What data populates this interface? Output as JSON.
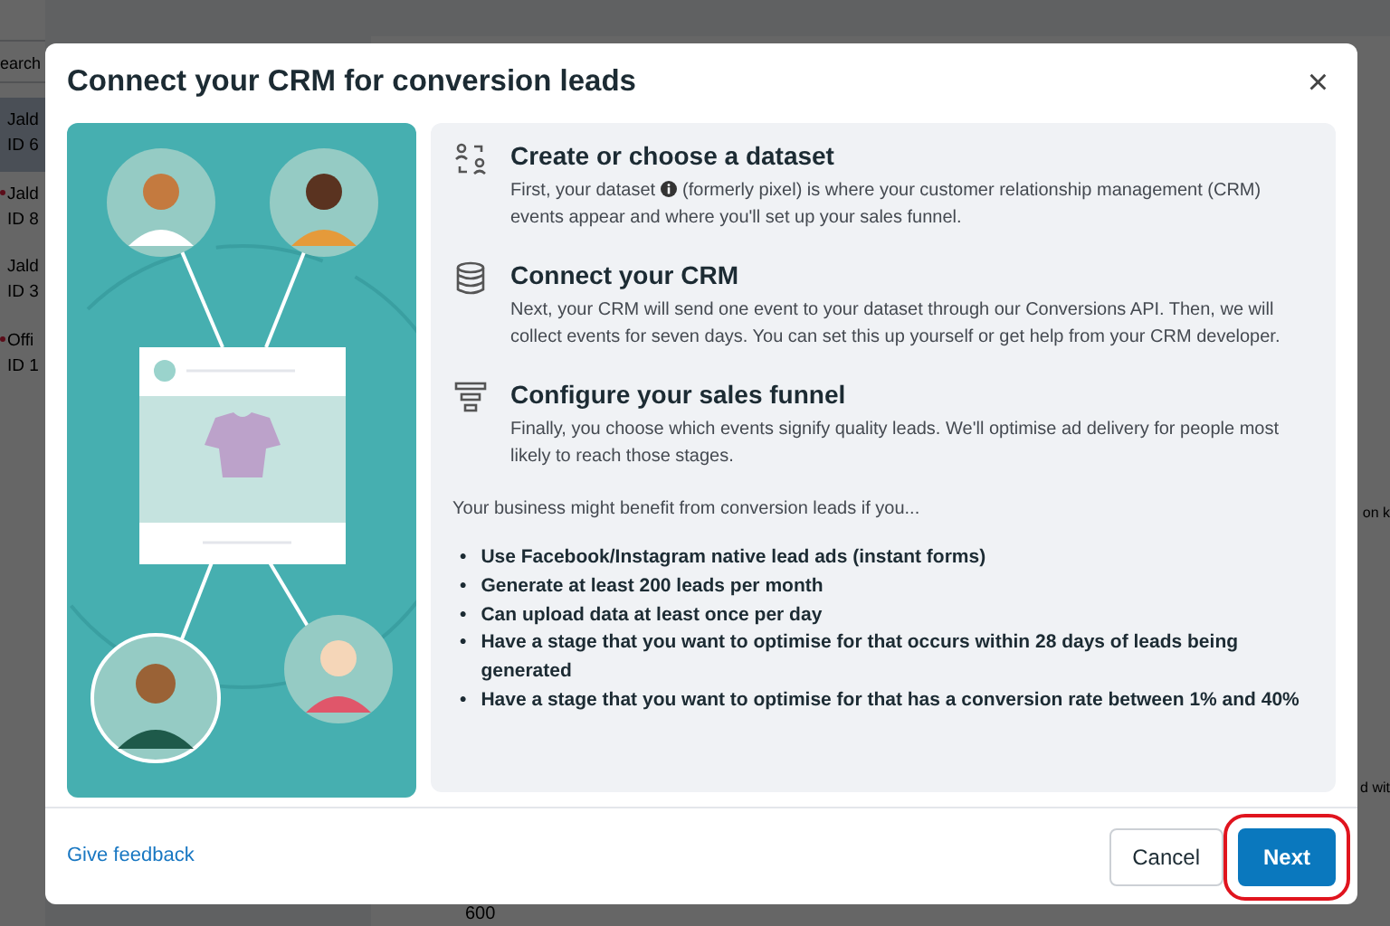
{
  "background": {
    "search_placeholder": "earch",
    "list": [
      {
        "title": "Jald",
        "subtitle": "ID 6",
        "selected": true,
        "alert": false
      },
      {
        "title": "Jald",
        "subtitle": "ID 8",
        "selected": false,
        "alert": true
      },
      {
        "title": "Jald",
        "subtitle": "ID 3",
        "selected": false,
        "alert": false
      },
      {
        "title": "Offi",
        "subtitle": "ID 1",
        "selected": false,
        "alert": true
      }
    ],
    "right_texts": [
      "on k",
      "d wit"
    ],
    "chart_label": "600"
  },
  "dialog": {
    "title": "Connect your CRM for conversion leads",
    "close": "×",
    "steps": [
      {
        "kind": "dataset",
        "title": "Create or choose a dataset",
        "description": [
          {
            "text": "First, your dataset",
            "info_icon": true
          },
          {
            "text": "(formerly pixel) is where your customer relationship management (CRM)",
            "info_icon": false
          },
          {
            "text": "events appear and where you'll set up your sales funnel.",
            "info_icon": false
          }
        ]
      },
      {
        "kind": "database",
        "title": "Connect your CRM",
        "description": [
          {
            "text": "Next, your CRM will send one event to your dataset through our Conversions API. Then, we will collect events for seven days. You can set this up yourself or get help from your CRM developer.",
            "info_icon": false
          }
        ]
      },
      {
        "kind": "funnel",
        "title": "Configure your sales funnel",
        "description": [
          {
            "text": "Finally, you choose which events signify quality leads. We'll optimise ad delivery for people most likely to reach those stages.",
            "info_icon": false
          }
        ]
      }
    ],
    "benefits_intro": "Your business might benefit from conversion leads if you...",
    "bullet": "•",
    "benefits": [
      "Use Facebook/Instagram native lead ads (instant forms)",
      "Generate at least 200 leads per month",
      "Can upload data at least once per day",
      "Have a stage that you want to optimise for that occurs within 28 days of leads being generated",
      "Have a stage that you want to optimise for that has a conversion rate between 1% and 40%"
    ],
    "feedback_link": "Give feedback",
    "buttons": [
      {
        "kind": "secondary",
        "label": "Cancel",
        "highlighted": false
      },
      {
        "kind": "primary",
        "label": "Next",
        "highlighted": true
      }
    ]
  }
}
